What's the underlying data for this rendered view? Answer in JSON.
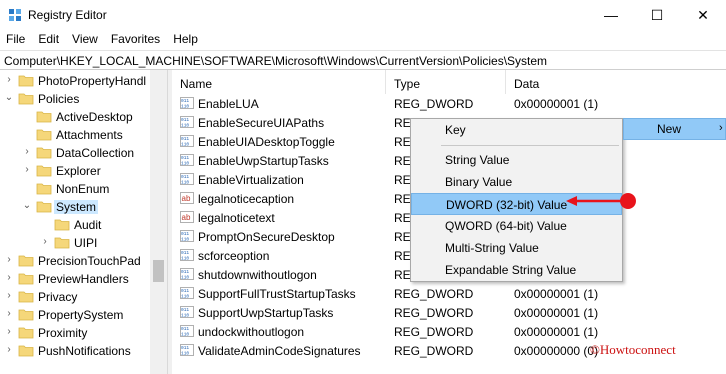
{
  "window": {
    "title": "Registry Editor",
    "minimize": "—",
    "maximize": "☐",
    "close": "✕"
  },
  "menu": [
    "File",
    "Edit",
    "View",
    "Favorites",
    "Help"
  ],
  "address": "Computer\\HKEY_LOCAL_MACHINE\\SOFTWARE\\Microsoft\\Windows\\CurrentVersion\\Policies\\System",
  "tree": [
    {
      "label": "PhotoPropertyHandl",
      "chevron": "›",
      "indent": 1
    },
    {
      "label": "Policies",
      "chevron": "⌄",
      "indent": 1
    },
    {
      "label": "ActiveDesktop",
      "chevron": "",
      "indent": 2
    },
    {
      "label": "Attachments",
      "chevron": "",
      "indent": 2
    },
    {
      "label": "DataCollection",
      "chevron": "›",
      "indent": 2
    },
    {
      "label": "Explorer",
      "chevron": "›",
      "indent": 2
    },
    {
      "label": "NonEnum",
      "chevron": "",
      "indent": 2
    },
    {
      "label": "System",
      "chevron": "⌄",
      "indent": 2,
      "selected": true
    },
    {
      "label": "Audit",
      "chevron": "",
      "indent": 3
    },
    {
      "label": "UIPI",
      "chevron": "›",
      "indent": 3
    },
    {
      "label": "PrecisionTouchPad",
      "chevron": "›",
      "indent": 1
    },
    {
      "label": "PreviewHandlers",
      "chevron": "›",
      "indent": 1
    },
    {
      "label": "Privacy",
      "chevron": "›",
      "indent": 1
    },
    {
      "label": "PropertySystem",
      "chevron": "›",
      "indent": 1
    },
    {
      "label": "Proximity",
      "chevron": "›",
      "indent": 1
    },
    {
      "label": "PushNotifications",
      "chevron": "›",
      "indent": 1
    }
  ],
  "columns": {
    "name": "Name",
    "type": "Type",
    "data": "Data"
  },
  "values": [
    {
      "icon": "dword",
      "name": "EnableLUA",
      "type": "REG_DWORD",
      "data": "0x00000001 (1)"
    },
    {
      "icon": "dword",
      "name": "EnableSecureUIAPaths",
      "type": "REG_",
      "data": ""
    },
    {
      "icon": "dword",
      "name": "EnableUIADesktopToggle",
      "type": "REG_",
      "data": ""
    },
    {
      "icon": "dword",
      "name": "EnableUwpStartupTasks",
      "type": "REG_",
      "data": ""
    },
    {
      "icon": "dword",
      "name": "EnableVirtualization",
      "type": "REG_",
      "data": ""
    },
    {
      "icon": "string",
      "name": "legalnoticecaption",
      "type": "REG_",
      "data": ""
    },
    {
      "icon": "string",
      "name": "legalnoticetext",
      "type": "REG_",
      "data": ""
    },
    {
      "icon": "dword",
      "name": "PromptOnSecureDesktop",
      "type": "REG_",
      "data": ""
    },
    {
      "icon": "dword",
      "name": "scforceoption",
      "type": "REG_",
      "data": ""
    },
    {
      "icon": "dword",
      "name": "shutdownwithoutlogon",
      "type": "REG_",
      "data": ""
    },
    {
      "icon": "dword",
      "name": "SupportFullTrustStartupTasks",
      "type": "REG_DWORD",
      "data": "0x00000001 (1)"
    },
    {
      "icon": "dword",
      "name": "SupportUwpStartupTasks",
      "type": "REG_DWORD",
      "data": "0x00000001 (1)"
    },
    {
      "icon": "dword",
      "name": "undockwithoutlogon",
      "type": "REG_DWORD",
      "data": "0x00000001 (1)"
    },
    {
      "icon": "dword",
      "name": "ValidateAdminCodeSignatures",
      "type": "REG_DWORD",
      "data": "0x00000000 (0)"
    }
  ],
  "context_menu": {
    "key": "Key",
    "items": [
      "String Value",
      "Binary Value",
      "DWORD (32-bit) Value",
      "QWORD (64-bit) Value",
      "Multi-String Value",
      "Expandable String Value"
    ],
    "highlighted": "DWORD (32-bit) Value"
  },
  "new_menu": {
    "label": "New",
    "arrow": "›"
  },
  "watermark": "©Howtoconnect",
  "colors": {
    "highlight": "#91c9f7",
    "annotation": "#e8131b",
    "folder": "#f5d77a"
  }
}
